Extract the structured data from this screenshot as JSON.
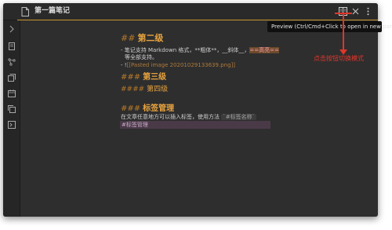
{
  "tab": {
    "title": "第一篇笔记",
    "icon": "document-icon"
  },
  "toolbar": {
    "icons": [
      "reading-view-icon",
      "close-icon",
      "more-options-icon"
    ]
  },
  "sidebar": {
    "icons": [
      "expand-chevron-icon",
      "file-icon",
      "graph-icon",
      "switcher-icon",
      "calendar-icon",
      "copy-icon",
      "command-icon"
    ]
  },
  "tooltip": {
    "text": "Preview (Ctrl/Cmd+Click to open in new pane)"
  },
  "annotation": {
    "text": "点击按钮切换模式"
  },
  "editor": {
    "h2_mark": "##",
    "h2_text": "第二级",
    "list1_prefix": "- 笔记支持 Markdown 格式，**粗体**，__斜体__，",
    "list1_highlight": "==高亮==",
    "list1_cont": "等全部支持。",
    "list2_prefix": "- !",
    "list2_link": "[[Pasted image 20201029133639.png]]",
    "h3_mark": "###",
    "h3_text": "第三级",
    "h4_mark": "####",
    "h4_text": "第四级",
    "h3b_mark": "###",
    "h3b_text": "标签管理",
    "tag_line": "在文章任意地方可以插入标签，使用方法",
    "tag_example": "`#标签名称`",
    "tag_row": "#标签管理"
  },
  "colors": {
    "accent": "#e8a33e",
    "annotation": "#e0352b",
    "background": "#2e2e2e"
  }
}
